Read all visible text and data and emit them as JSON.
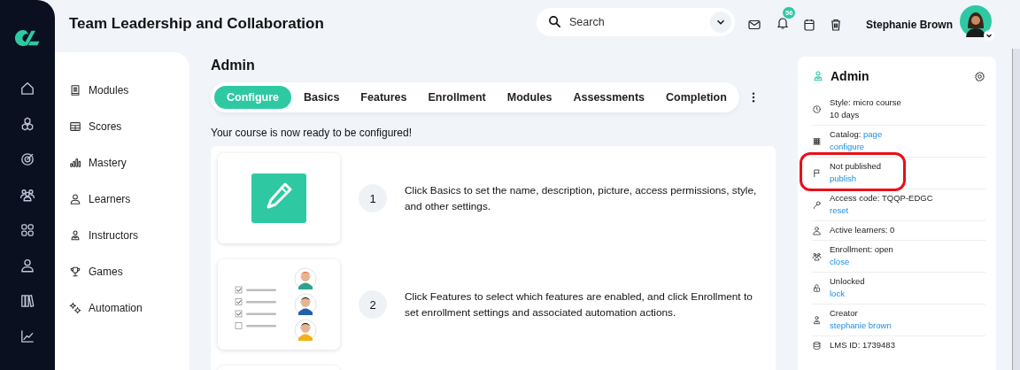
{
  "header": {
    "title": "Team Leadership and Collaboration",
    "search": {
      "placeholder": "Search"
    },
    "notification_count": "56",
    "user_name": "Stephanie Brown"
  },
  "sidebar": {
    "items": [
      {
        "label": "Modules"
      },
      {
        "label": "Scores"
      },
      {
        "label": "Mastery"
      },
      {
        "label": "Learners"
      },
      {
        "label": "Instructors"
      },
      {
        "label": "Games"
      },
      {
        "label": "Automation"
      }
    ]
  },
  "main": {
    "heading": "Admin",
    "tabs": [
      {
        "label": "Configure",
        "selected": true
      },
      {
        "label": "Basics",
        "selected": false
      },
      {
        "label": "Features",
        "selected": false
      },
      {
        "label": "Enrollment",
        "selected": false
      },
      {
        "label": "Modules",
        "selected": false
      },
      {
        "label": "Assessments",
        "selected": false
      },
      {
        "label": "Completion",
        "selected": false
      }
    ],
    "intro": "Your course is now ready to be configured!",
    "steps": [
      {
        "number": "1",
        "kind": "pencil",
        "text": "Click Basics to set the name, description, picture, access permissions, style, and other settings."
      },
      {
        "number": "2",
        "kind": "checklist",
        "text": "Click Features to select which features are enabled, and click Enrollment to set enrollment settings and associated automation actions."
      }
    ]
  },
  "details": {
    "title": "Admin",
    "items": [
      {
        "text": "Style: micro course",
        "note": "10 days",
        "highlighted": false
      },
      {
        "text": "Catalog:",
        "inline_link": "page",
        "link": "configure",
        "highlighted": false
      },
      {
        "text": "Not published",
        "link": "publish",
        "highlighted": true
      },
      {
        "text": "Access code: TQQP-EDGC",
        "link": "reset",
        "highlighted": false
      },
      {
        "text": "Active learners: 0",
        "highlighted": false
      },
      {
        "text": "Enrollment: open",
        "link": "close",
        "highlighted": false
      },
      {
        "text": "Unlocked",
        "link": "lock",
        "highlighted": false
      },
      {
        "text": "Creator",
        "link": "stephanie brown",
        "highlighted": false
      },
      {
        "text": "LMS ID: 1739483",
        "highlighted": false
      }
    ]
  }
}
